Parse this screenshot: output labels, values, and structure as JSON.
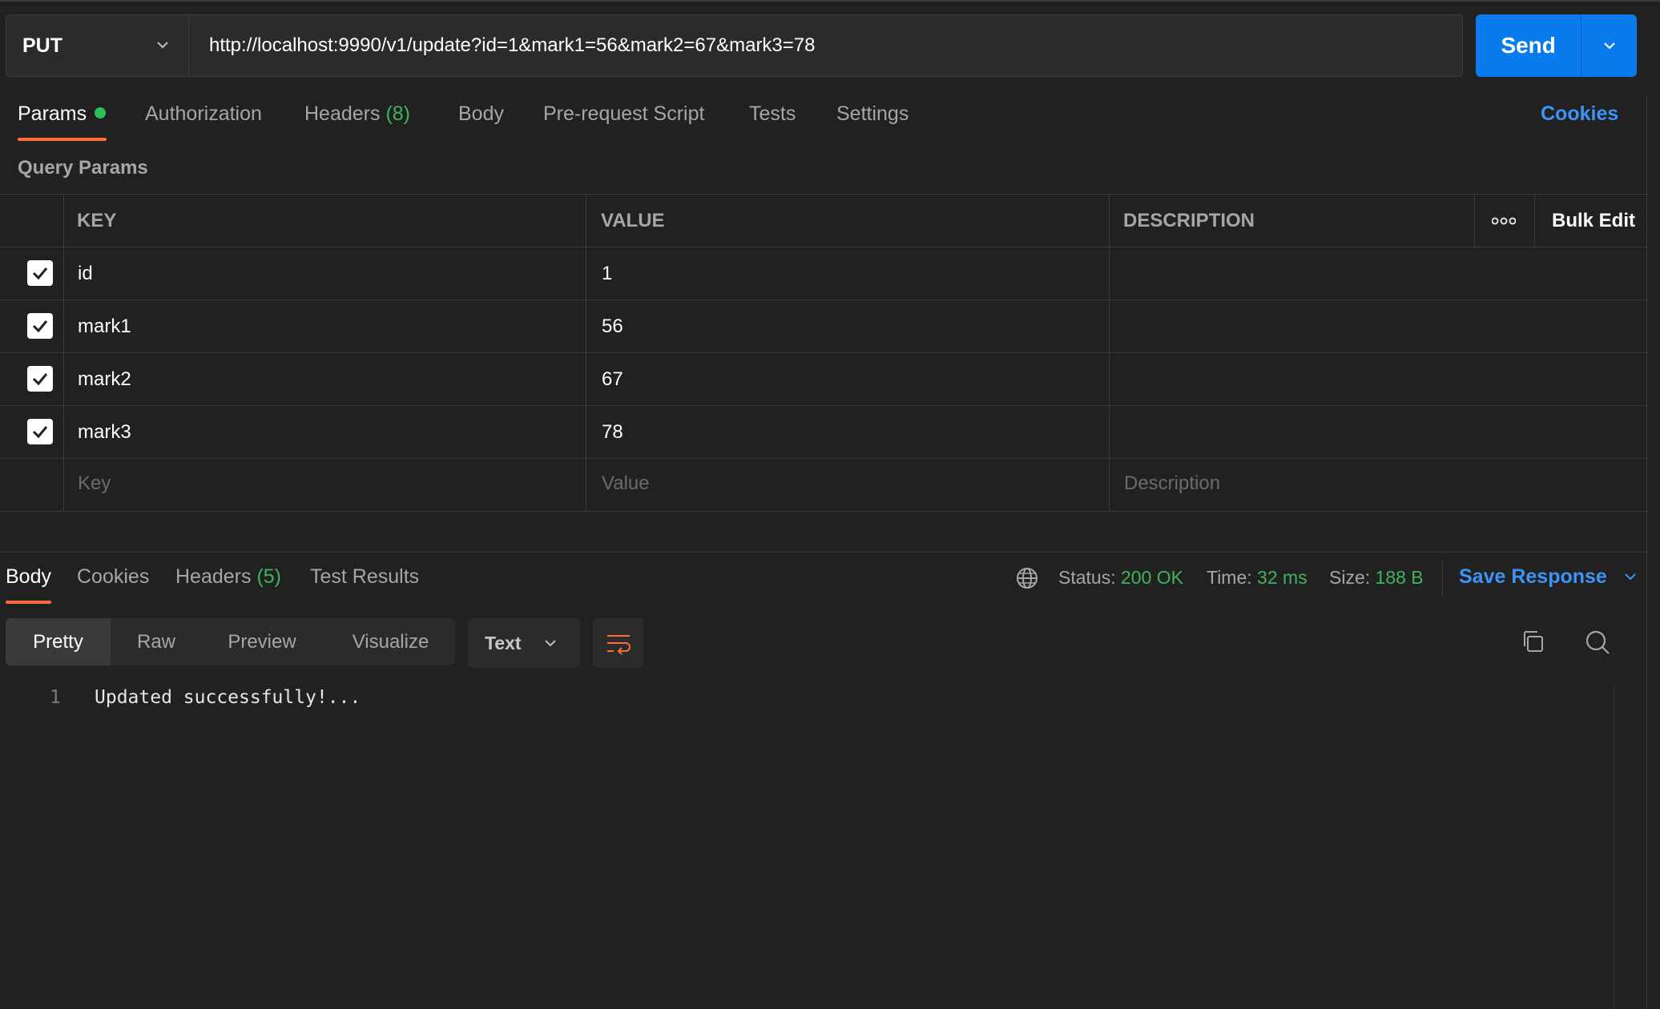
{
  "request": {
    "method": "PUT",
    "url": "http://localhost:9990/v1/update?id=1&mark1=56&mark2=67&mark3=78",
    "send_label": "Send"
  },
  "request_tabs": {
    "params": "Params",
    "authorization": "Authorization",
    "headers": "Headers",
    "headers_count": "(8)",
    "body": "Body",
    "prerequest": "Pre-request Script",
    "tests": "Tests",
    "settings": "Settings",
    "cookies": "Cookies"
  },
  "query_params": {
    "title": "Query Params",
    "columns": {
      "key": "KEY",
      "value": "VALUE",
      "description": "DESCRIPTION"
    },
    "bulk_edit": "Bulk Edit",
    "rows": [
      {
        "key": "id",
        "value": "1",
        "checked": true
      },
      {
        "key": "mark1",
        "value": "56",
        "checked": true
      },
      {
        "key": "mark2",
        "value": "67",
        "checked": true
      },
      {
        "key": "mark3",
        "value": "78",
        "checked": true
      }
    ],
    "placeholders": {
      "key": "Key",
      "value": "Value",
      "description": "Description"
    }
  },
  "response": {
    "tabs": {
      "body": "Body",
      "cookies": "Cookies",
      "headers": "Headers",
      "headers_count": "(5)",
      "test_results": "Test Results"
    },
    "status_label": "Status:",
    "status_value": "200 OK",
    "time_label": "Time:",
    "time_value": "32 ms",
    "size_label": "Size:",
    "size_value": "188 B",
    "save_response": "Save Response",
    "views": {
      "pretty": "Pretty",
      "raw": "Raw",
      "preview": "Preview",
      "visualize": "Visualize"
    },
    "format": "Text",
    "lines": [
      {
        "number": "1",
        "text": "Updated successfully!..."
      }
    ]
  },
  "colors": {
    "accent_orange": "#ff6c37",
    "send_blue": "#097bed",
    "link_blue": "#3d94f6",
    "success_green": "#3fb45d",
    "background": "#212121"
  },
  "icons": {
    "method_dropdown": "chevron-down-icon",
    "send_dropdown": "chevron-down-icon",
    "params_active": "green-dot",
    "row_menu": "more-horizontal-icon",
    "row_check": "checkbox-checked-icon",
    "globe": "globe-icon",
    "wrap": "wrap-lines-icon",
    "copy": "copy-icon",
    "search": "search-icon"
  }
}
